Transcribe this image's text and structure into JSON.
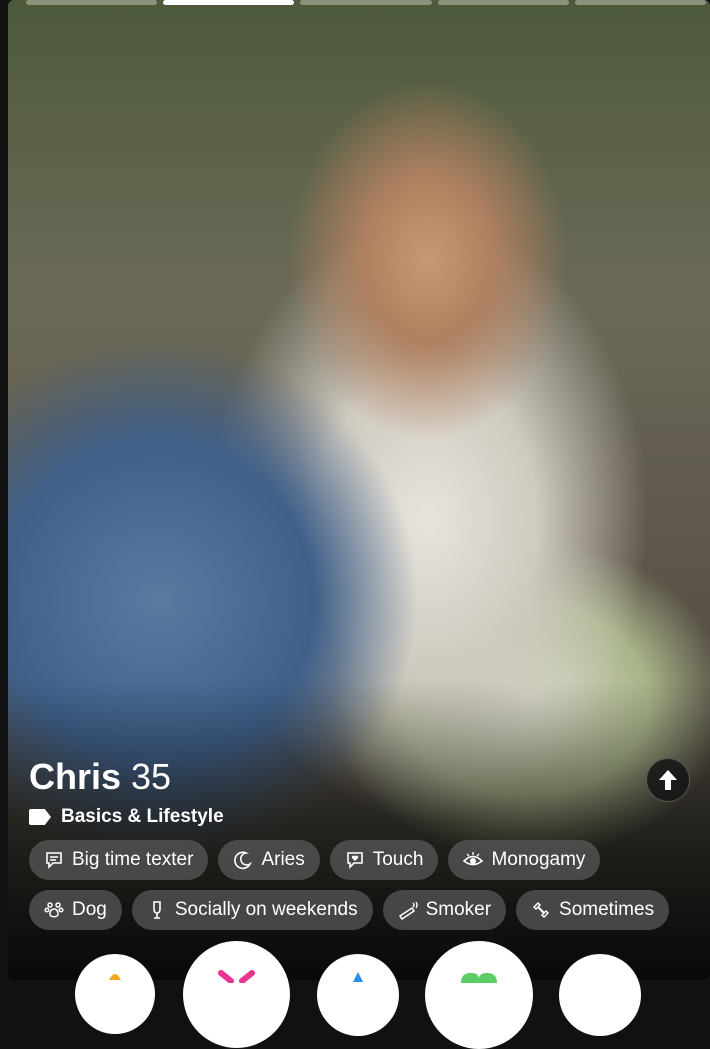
{
  "profile": {
    "name": "Chris",
    "age": "35",
    "section_title": "Basics & Lifestyle"
  },
  "progress": {
    "total": 5,
    "active_index": 1
  },
  "chips_row1": [
    {
      "label": "Big time texter",
      "icon": "chat-bubble-icon"
    },
    {
      "label": "Aries",
      "icon": "moon-icon"
    },
    {
      "label": "Touch",
      "icon": "heart-bubble-icon"
    },
    {
      "label": "Monogamy",
      "icon": "eye-icon"
    }
  ],
  "chips_row2": [
    {
      "label": "Dog",
      "icon": "paw-icon"
    },
    {
      "label": "Socially on weekends",
      "icon": "drink-icon"
    },
    {
      "label": "Smoker",
      "icon": "smoking-icon"
    },
    {
      "label": "Sometimes",
      "icon": "dumbbell-icon"
    }
  ],
  "action_buttons": [
    "rewind-button",
    "nope-button",
    "super-like-button",
    "like-button",
    "boost-button"
  ]
}
